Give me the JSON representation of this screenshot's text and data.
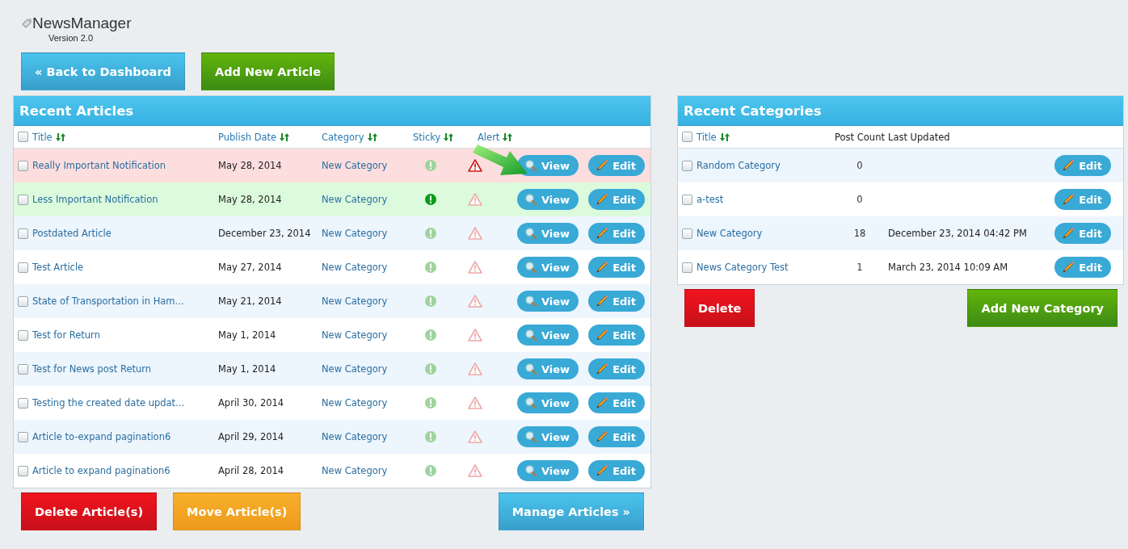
{
  "app": {
    "name": "NewsManager",
    "version": "Version 2.0"
  },
  "top_buttons": [
    {
      "label": "« Back to Dashboard",
      "kind": "blue"
    },
    {
      "label": "Add New Article",
      "kind": "green"
    }
  ],
  "articles": {
    "title": "Recent Articles",
    "columns": [
      "Title",
      "Publish Date",
      "Category",
      "Sticky",
      "Alert"
    ],
    "header_checked": false,
    "rows": [
      {
        "title": "Really Important Notification",
        "date": "May 28, 2014",
        "category": "New Category",
        "sticky": false,
        "alert": true,
        "checked": false,
        "view": "View",
        "edit": "Edit"
      },
      {
        "title": "Less Important Notification",
        "date": "May 28, 2014",
        "category": "New Category",
        "sticky": true,
        "alert": false,
        "checked": false,
        "view": "View",
        "edit": "Edit"
      },
      {
        "title": "Postdated Article",
        "date": "December 23, 2014",
        "category": "New Category",
        "sticky": false,
        "alert": false,
        "checked": false,
        "view": "View",
        "edit": "Edit"
      },
      {
        "title": "Test Article",
        "date": "May 27, 2014",
        "category": "New Category",
        "sticky": false,
        "alert": false,
        "checked": false,
        "view": "View",
        "edit": "Edit"
      },
      {
        "title": "State of Transportation in Ham...",
        "date": "May 21, 2014",
        "category": "New Category",
        "sticky": false,
        "alert": false,
        "checked": false,
        "view": "View",
        "edit": "Edit"
      },
      {
        "title": "Test for Return",
        "date": "May 1, 2014",
        "category": "New Category",
        "sticky": false,
        "alert": false,
        "checked": false,
        "view": "View",
        "edit": "Edit"
      },
      {
        "title": "Test for News post Return",
        "date": "May 1, 2014",
        "category": "New Category",
        "sticky": false,
        "alert": false,
        "checked": false,
        "view": "View",
        "edit": "Edit"
      },
      {
        "title": "Testing the created date updat...",
        "date": "April 30, 2014",
        "category": "New Category",
        "sticky": false,
        "alert": false,
        "checked": false,
        "view": "View",
        "edit": "Edit"
      },
      {
        "title": "Article to-expand pagination6",
        "date": "April 29, 2014",
        "category": "New Category",
        "sticky": false,
        "alert": false,
        "checked": false,
        "view": "View",
        "edit": "Edit"
      },
      {
        "title": "Article to expand pagination6",
        "date": "April 28, 2014",
        "category": "New Category",
        "sticky": false,
        "alert": false,
        "checked": false,
        "view": "View",
        "edit": "Edit"
      }
    ],
    "buttons": [
      {
        "label": "Delete Article(s)",
        "kind": "red"
      },
      {
        "label": "Move Article(s)",
        "kind": "orange"
      },
      {
        "label": "Manage Articles »",
        "kind": "blue"
      }
    ]
  },
  "categories": {
    "title": "Recent Categories",
    "columns": [
      "Title",
      "Post Count",
      "Last Updated"
    ],
    "header_checked": false,
    "rows": [
      {
        "title": "Random Category",
        "count": "0",
        "checked": false,
        "edit": "Edit"
      },
      {
        "title": "a-test",
        "count": "0",
        "checked": false,
        "edit": "Edit"
      },
      {
        "title": "New Category",
        "count": "18",
        "updated": "December 23, 2014 04:42 PM",
        "checked": false,
        "edit": "Edit"
      },
      {
        "title": "News Category Test",
        "count": "1",
        "updated": "March 23, 2014 10:09 AM",
        "checked": false,
        "edit": "Edit"
      }
    ],
    "buttons": [
      {
        "label": "Delete",
        "kind": "red"
      },
      {
        "label": "Add New Category",
        "kind": "green"
      }
    ]
  }
}
